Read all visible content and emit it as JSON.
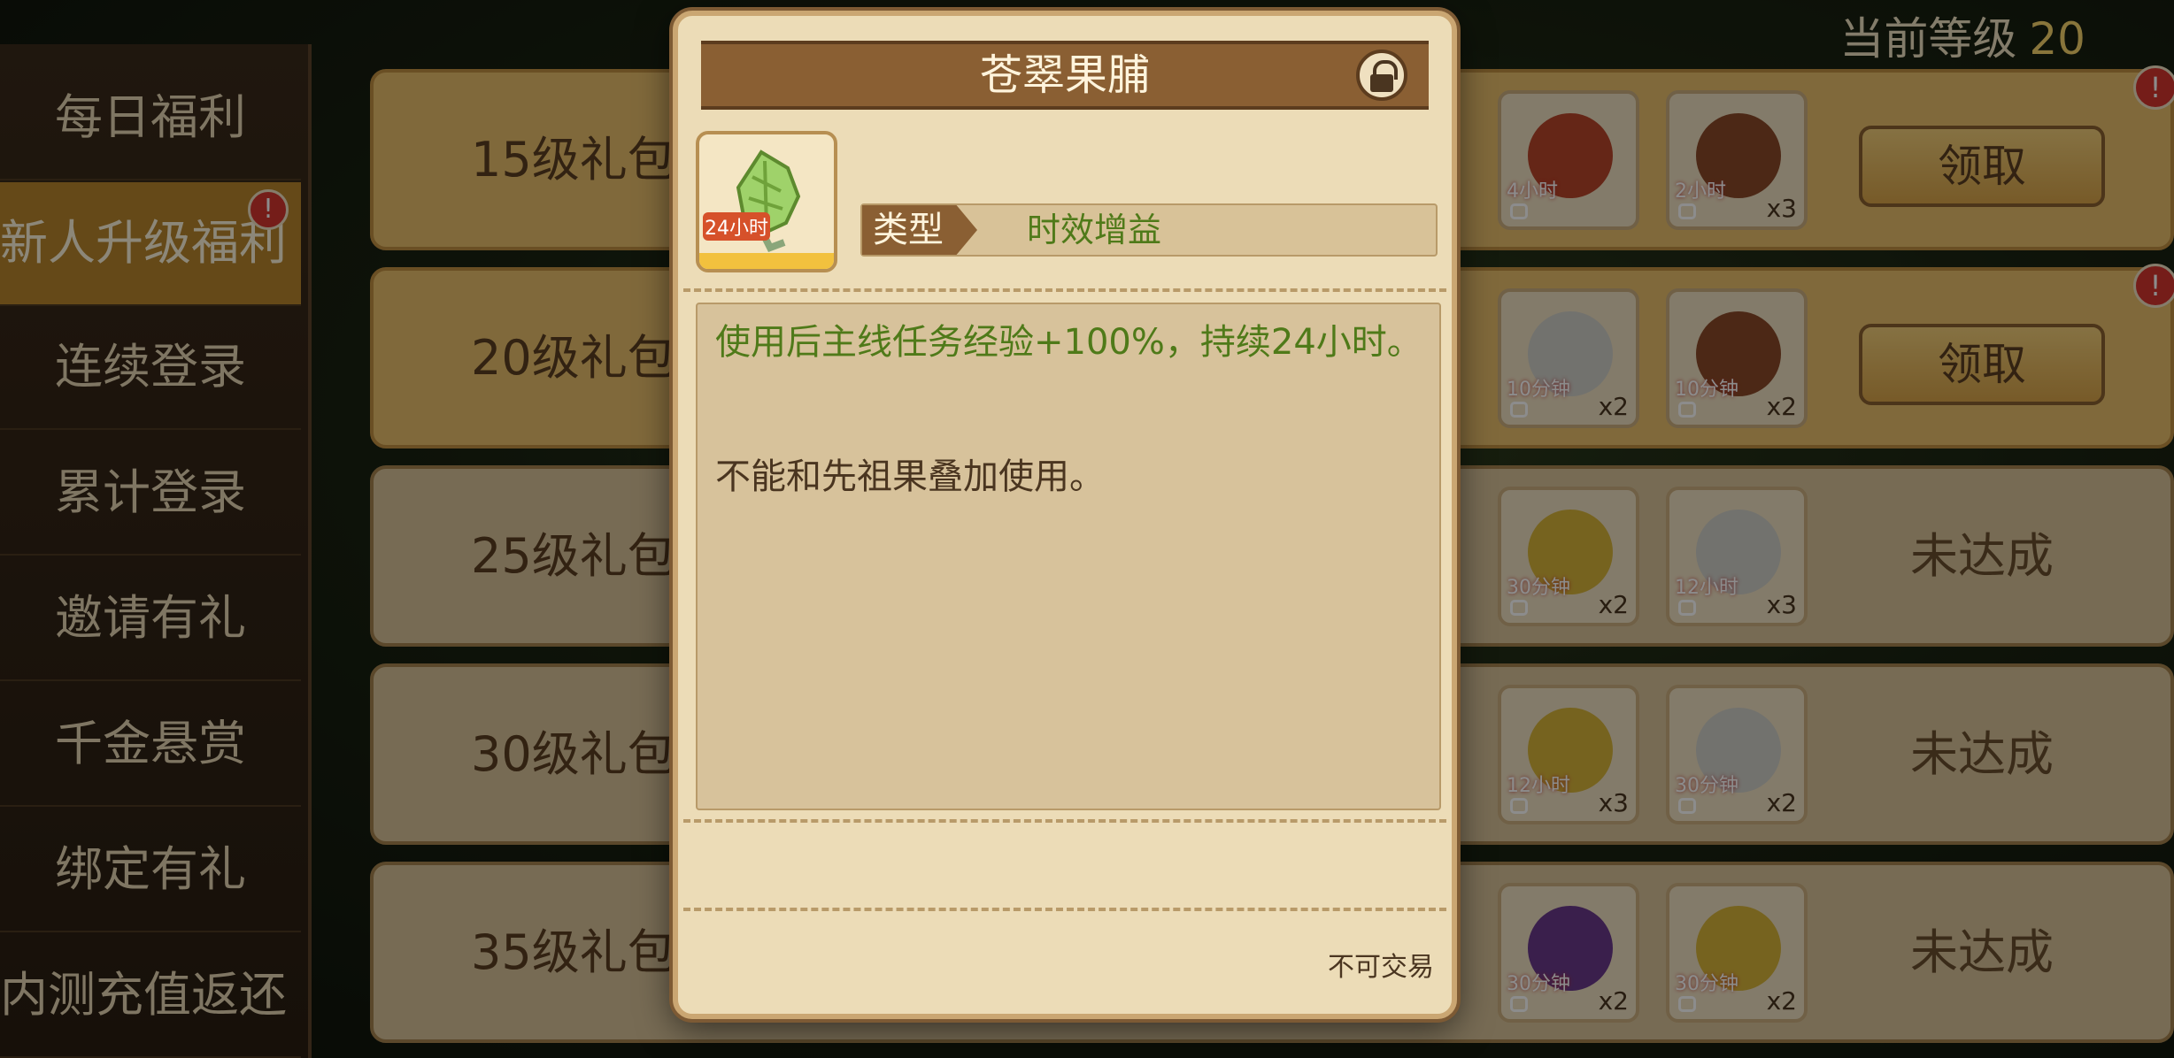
{
  "header": {
    "level_label": "当前等级",
    "level_value": "20"
  },
  "sidebar": {
    "items": [
      {
        "label": "每日福利"
      },
      {
        "label": "新人升级福利",
        "active": true,
        "badge": "!"
      },
      {
        "label": "连续登录"
      },
      {
        "label": "累计登录"
      },
      {
        "label": "邀请有礼"
      },
      {
        "label": "千金悬赏"
      },
      {
        "label": "绑定有礼"
      },
      {
        "label": "内测充值返还"
      }
    ]
  },
  "rows": [
    {
      "title": "15级礼包",
      "action": "领取",
      "badge": "!",
      "items": [
        {
          "time": "4小时",
          "qty": ""
        },
        {
          "time": "2小时",
          "qty": "x3"
        }
      ]
    },
    {
      "title": "20级礼包",
      "action": "领取",
      "badge": "!",
      "items": [
        {
          "time": "10分钟",
          "qty": "x2"
        },
        {
          "time": "10分钟",
          "qty": "x2"
        }
      ]
    },
    {
      "title": "25级礼包",
      "status": "未达成",
      "items": [
        {
          "time": "30分钟",
          "qty": "x2"
        },
        {
          "time": "12小时",
          "qty": "x3"
        }
      ]
    },
    {
      "title": "30级礼包",
      "status": "未达成",
      "items": [
        {
          "time": "12小时",
          "qty": "x3"
        },
        {
          "time": "30分钟",
          "qty": "x2"
        }
      ]
    },
    {
      "title": "35级礼包",
      "status": "未达成",
      "items": [
        {
          "time": "30分钟",
          "qty": "x2"
        },
        {
          "time": "30分钟",
          "qty": "x2"
        }
      ]
    }
  ],
  "popup": {
    "title": "苍翠果脯",
    "icon_time": "24小时",
    "type_label": "类型",
    "type_value": "时效增益",
    "desc_green": "使用后主线任务经验+100%，持续24小时。",
    "desc_brown": "不能和先祖果叠加使用。",
    "trade_note": "不可交易"
  },
  "colors": {
    "accent_green": "#4f7a19",
    "header_brown": "#8a5f33",
    "badge_red": "#d6362f"
  }
}
